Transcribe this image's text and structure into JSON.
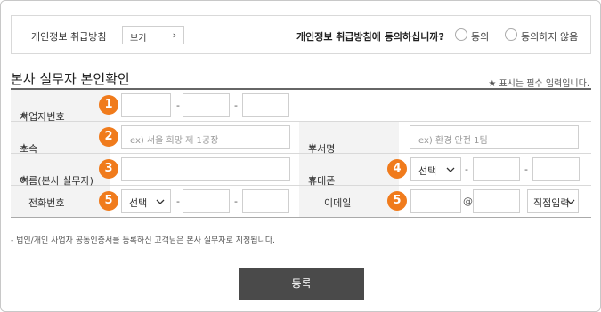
{
  "privacy": {
    "label": "개인정보 취급방침",
    "view_button": "보기",
    "view_chevron": "›",
    "question": "개인정보 취급방침에 동의하십니까?",
    "agree": "동의",
    "disagree": "동의하지 않음"
  },
  "section": {
    "title": "본사 실무자 본인확인",
    "required_note": "★ 표시는 필수 입력입니다."
  },
  "form": {
    "star": "★",
    "business_number": {
      "label": "사업자번호",
      "step": "1",
      "dash": "-"
    },
    "affiliation": {
      "label": "소속",
      "step": "2",
      "placeholder": "ex) 서울 희망 제 1공장"
    },
    "department": {
      "label": "부서명",
      "placeholder": "ex) 환경 안전 1팀"
    },
    "name": {
      "label": "이름(본사 실무자)",
      "step": "3"
    },
    "mobile": {
      "label": "휴대폰",
      "step": "4",
      "select": "선택",
      "dash": "-"
    },
    "phone": {
      "label": "전화번호",
      "step": "5",
      "select": "선택",
      "dash": "-"
    },
    "email": {
      "label": "이메일",
      "step": "5",
      "at": "@",
      "domain_select": "직접입력"
    }
  },
  "footnote": "- 법인/개인 사업자 공동인증서를 등록하신 고객님은 본사 실무자로 지정됩니다.",
  "submit_label": "등록",
  "colors": {
    "badge": "#f07b1c",
    "submit_bg": "#4a4a4a",
    "label_bg": "#f3f3f3"
  }
}
